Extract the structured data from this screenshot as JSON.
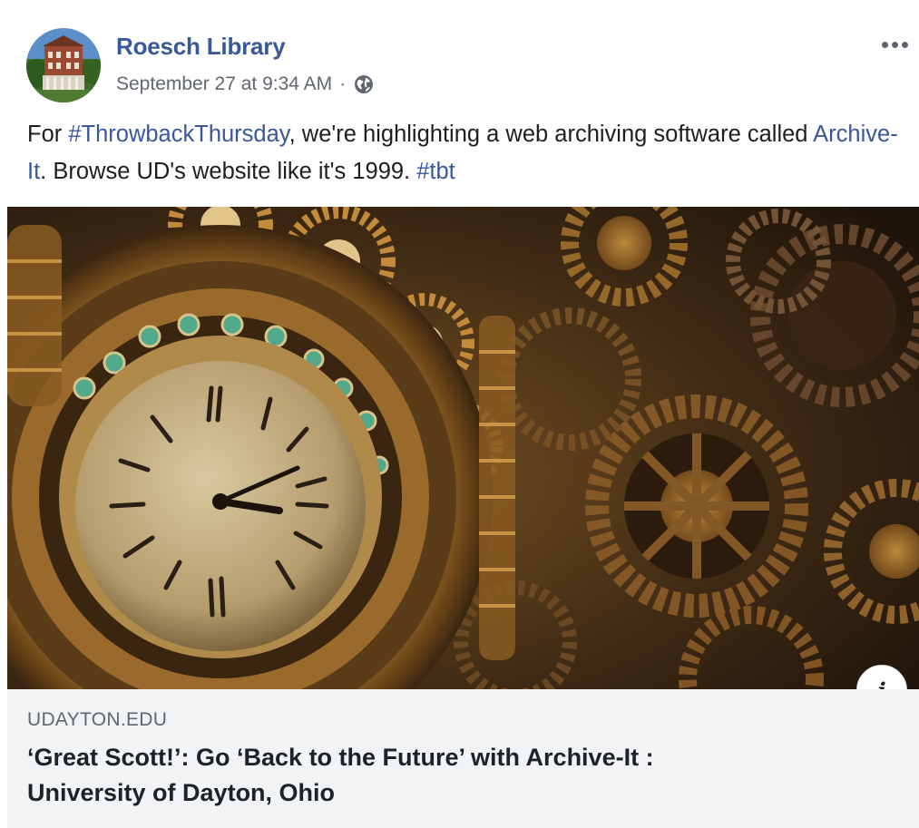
{
  "post": {
    "page_name": "Roesch Library",
    "timestamp": "September 27 at 9:34 AM",
    "separator": "·",
    "privacy_icon": "globe-icon",
    "more_icon": "more-options-icon",
    "text": {
      "part1": "For ",
      "hashtag1": "#ThrowbackThursday",
      "part2": ", we're highlighting a web archiving software called ",
      "link": "Archive-It",
      "part3": ". Browse UD's website like it's 1999. ",
      "hashtag2": "#tbt"
    }
  },
  "link_preview": {
    "image_description_icon": "clock-and-gears-image",
    "info_button_label": "i",
    "domain": "UDAYTON.EDU",
    "title_line1": "‘Great Scott!’: Go ‘Back to the Future’ with Archive-It :",
    "title_line2": "University of Dayton, Ohio"
  },
  "colors": {
    "link_blue": "#385898",
    "meta_gray": "#606770",
    "caption_bg": "#f2f3f5"
  }
}
